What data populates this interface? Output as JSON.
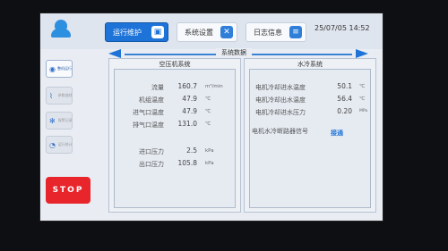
{
  "topbar": {
    "tabs": [
      {
        "label": "运行维护",
        "icon": "monitor-icon",
        "active": true
      },
      {
        "label": "系统设置",
        "icon": "wrench-icon",
        "active": false
      },
      {
        "label": "日志信息",
        "icon": "document-icon",
        "active": false
      }
    ],
    "datetime": "25/07/05 14:52"
  },
  "section_title": "系统数据",
  "sidebar": {
    "items": [
      {
        "label": "整机运行状态",
        "icon": "status-icon",
        "active": true
      },
      {
        "label": "参数曲线",
        "icon": "chart-icon",
        "active": false
      },
      {
        "label": "报警记录",
        "icon": "fan-icon",
        "active": false
      },
      {
        "label": "运行统计",
        "icon": "pie-icon",
        "active": false
      }
    ],
    "stop_label": "STOP"
  },
  "compressor": {
    "title": "空压机系统",
    "rows": [
      {
        "label": "流量",
        "value": "160.7",
        "unit": "m³/min"
      },
      {
        "label": "机组温度",
        "value": "47.9",
        "unit": "℃"
      },
      {
        "label": "进气口温度",
        "value": "47.9",
        "unit": "℃"
      },
      {
        "label": "排气口温度",
        "value": "131.0",
        "unit": "℃"
      },
      {
        "label": "进口压力",
        "value": "2.5",
        "unit": "kPa"
      },
      {
        "label": "出口压力",
        "value": "105.8",
        "unit": "kPa"
      }
    ]
  },
  "water_cooling": {
    "title": "水冷系统",
    "rows": [
      {
        "label": "电机冷却进水温度",
        "value": "50.1",
        "unit": "℃"
      },
      {
        "label": "电机冷却出水温度",
        "value": "56.4",
        "unit": "℃"
      },
      {
        "label": "电机冷却进水压力",
        "value": "0.20",
        "unit": "MPa"
      }
    ],
    "signal_label": "电机水冷断路器信号",
    "signal_value": "接通"
  },
  "colors": {
    "accent": "#1e73d8",
    "stop": "#e8252b",
    "panel": "#e6ebf2"
  }
}
